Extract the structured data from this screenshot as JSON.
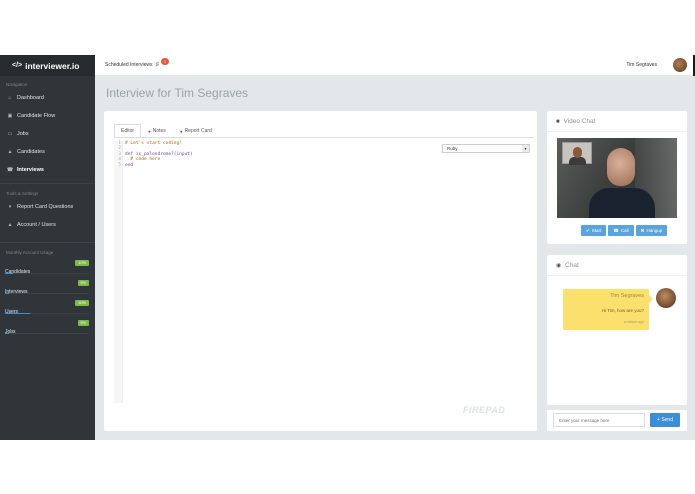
{
  "brand": {
    "title": "interviewer.io",
    "icon": "code-icon"
  },
  "sidebar": {
    "navigation_label": "Navigation",
    "nav_items": [
      {
        "label": "Dashboard",
        "icon": "dashboard-icon",
        "glyph": "⌂"
      },
      {
        "label": "Candidate Flow",
        "icon": "flow-icon",
        "glyph": "▣"
      },
      {
        "label": "Jobs",
        "icon": "jobs-icon",
        "glyph": "▭"
      },
      {
        "label": "Candidates",
        "icon": "user-icon",
        "glyph": "▲"
      },
      {
        "label": "Interviews",
        "icon": "phone-icon",
        "glyph": "☎"
      }
    ],
    "tools_label": "Tools & Settings",
    "tool_items": [
      {
        "label": "Report Card Questions",
        "icon": "pin-icon",
        "glyph": "▾"
      },
      {
        "label": "Account / Users",
        "icon": "user-icon",
        "glyph": "▲"
      }
    ],
    "usage_label": "Monthly Account Usage",
    "usage": [
      {
        "label": "Candidates",
        "percent": "10%",
        "value": 0.1
      },
      {
        "label": "Interviews",
        "percent": "5%",
        "value": 0.05
      },
      {
        "label": "Users",
        "percent": "30%",
        "value": 0.3
      },
      {
        "label": "Jobs",
        "percent": "5%",
        "value": 0.05
      }
    ]
  },
  "topbar": {
    "scheduled": "Scheduled Interviews",
    "badge": "1",
    "user_name": "Tim Segraves"
  },
  "page": {
    "title": "Interview for Tim Segraves"
  },
  "editor": {
    "tabs": [
      {
        "label": "Editor",
        "icon": ""
      },
      {
        "label": "Notes",
        "icon": "lock-icon"
      },
      {
        "label": "Report Card",
        "icon": "lock-icon"
      }
    ],
    "language": "Ruby",
    "line_numbers": [
      "1",
      "2",
      "3",
      "4",
      "5"
    ],
    "code_lines": [
      {
        "text": "# Let's start coding!",
        "type": "comment"
      },
      {
        "text": "",
        "type": "plain"
      },
      {
        "text": "def is_palendrome?(input)",
        "type": "def"
      },
      {
        "text": "  # code here",
        "type": "comment"
      },
      {
        "text": "end",
        "type": "kw"
      }
    ],
    "watermark": "FIREPAD"
  },
  "video_chat": {
    "title": "Video Chat",
    "buttons": [
      {
        "label": "Start",
        "glyph": "✔"
      },
      {
        "label": "Call",
        "glyph": "☎"
      },
      {
        "label": "Hangup",
        "glyph": "✖"
      }
    ]
  },
  "chat": {
    "title": "Chat",
    "messages": [
      {
        "name": "Tim Segraves",
        "text": "Hi Tim, how are you?",
        "time": "a minute ago"
      }
    ],
    "input_placeholder": "Enter your message here",
    "send_label": "Send"
  }
}
